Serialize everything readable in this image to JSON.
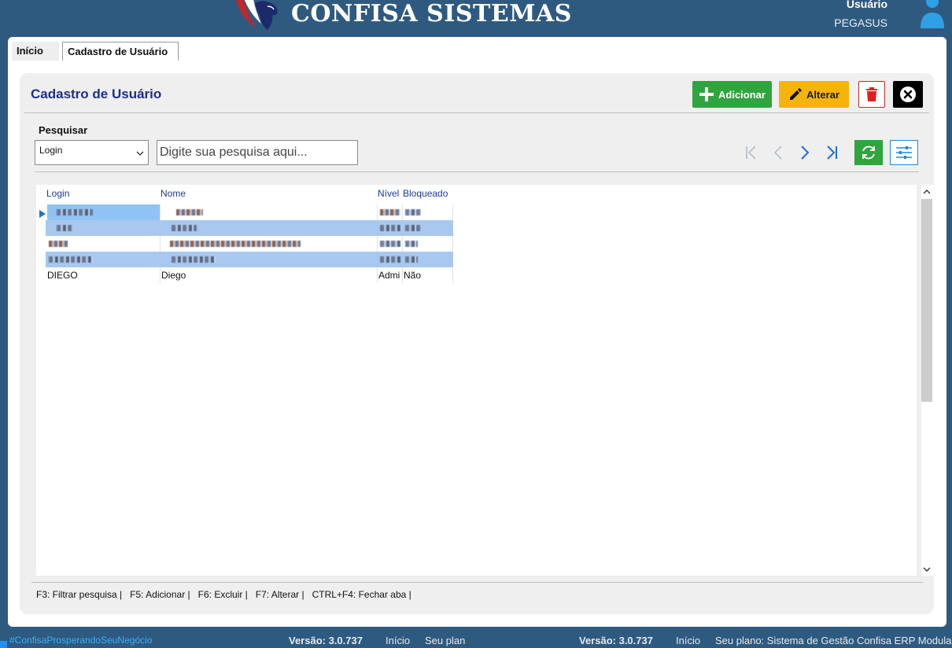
{
  "header": {
    "brand": "CONFISA SISTEMAS",
    "user_label": "Usuário",
    "user_name": "PEGASUS",
    "logo_icon": "pegasus-logo-icon",
    "user_icon": "user-avatar-icon"
  },
  "tabs": [
    {
      "label": "Início",
      "active": false
    },
    {
      "label": "Cadastro de Usuário",
      "active": true
    }
  ],
  "card": {
    "title": "Cadastro de Usuário",
    "buttons": {
      "add": "Adicionar",
      "edit": "Alterar",
      "delete_icon": "trash-icon",
      "close_icon": "close-icon"
    },
    "search": {
      "label": "Pesquisar",
      "field_value": "Login",
      "placeholder": "Digite sua pesquisa aqui..."
    },
    "nav_icons": [
      "first-page-icon",
      "prev-page-icon",
      "next-page-icon",
      "last-page-icon"
    ],
    "refresh_icon": "refresh-icon",
    "filter_icon": "sliders-icon"
  },
  "grid": {
    "columns": [
      "Login",
      "Nome",
      "Nível",
      "Bloqueado"
    ],
    "rows": [
      {
        "login": "",
        "nome": "",
        "nivel": "",
        "bloqueado": "",
        "redacted": true
      },
      {
        "login": "",
        "nome": "",
        "nivel": "",
        "bloqueado": "",
        "redacted": true
      },
      {
        "login": "",
        "nome": "",
        "nivel": "",
        "bloqueado": "",
        "redacted": true
      },
      {
        "login": "",
        "nome": "",
        "nivel": "",
        "bloqueado": "",
        "redacted": true
      },
      {
        "login": "DIEGO",
        "nome": "Diego",
        "nivel": "Admi",
        "bloqueado": "Não",
        "redacted": false
      }
    ]
  },
  "shortcuts": "F3: Filtrar pesquisa |   F5: Adicionar |   F6: Excluir |   F7: Alterar |   CTRL+F4: Fechar aba |",
  "footer": {
    "tag": "#ConfisaProsperandoSeuNegócio",
    "version_a": "Versão: 3.0.737",
    "inicio_a": "Início",
    "plan_a": "Seu plan",
    "version_b": "Versão: 3.0.737",
    "inicio_b": "Início",
    "plan_b": "Seu plano: Sistema de Gestão Confisa ERP Modular"
  },
  "colors": {
    "brand_blue": "#2f5a80",
    "add_green": "#2ea53e",
    "edit_yellow": "#f6b40a",
    "title_navy": "#1b2f8a",
    "selected_row": "#a9c8ef"
  }
}
